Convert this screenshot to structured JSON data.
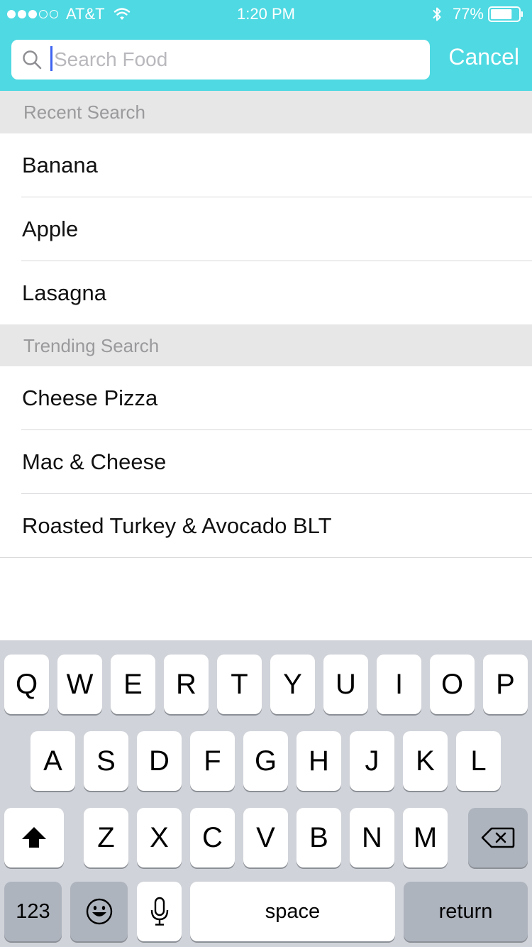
{
  "status_bar": {
    "carrier": "AT&T",
    "time": "1:20 PM",
    "battery_percent": "77%",
    "battery_level": 0.77,
    "signal_bars_filled": 3,
    "signal_bars_total": 5
  },
  "search": {
    "placeholder": "Search Food",
    "value": "",
    "cancel_label": "Cancel"
  },
  "recent": {
    "header": "Recent Search",
    "items": [
      "Banana",
      "Apple",
      "Lasagna"
    ]
  },
  "trending": {
    "header": "Trending Search",
    "items": [
      "Cheese Pizza",
      "Mac & Cheese",
      "Roasted Turkey & Avocado BLT"
    ]
  },
  "keyboard": {
    "row1": [
      "Q",
      "W",
      "E",
      "R",
      "T",
      "Y",
      "U",
      "I",
      "O",
      "P"
    ],
    "row2": [
      "A",
      "S",
      "D",
      "F",
      "G",
      "H",
      "J",
      "K",
      "L"
    ],
    "row3": [
      "Z",
      "X",
      "C",
      "V",
      "B",
      "N",
      "M"
    ],
    "numbers_label": "123",
    "space_label": "space",
    "return_label": "return"
  },
  "colors": {
    "accent": "#4fd9e2",
    "keyboard_bg": "#d0d3d9",
    "dark_key": "#aeb4be",
    "caret": "#3c63f0"
  },
  "icons": [
    "wifi-icon",
    "bluetooth-icon",
    "battery-icon",
    "search-icon",
    "shift-icon",
    "backspace-icon",
    "emoji-icon",
    "microphone-icon"
  ]
}
